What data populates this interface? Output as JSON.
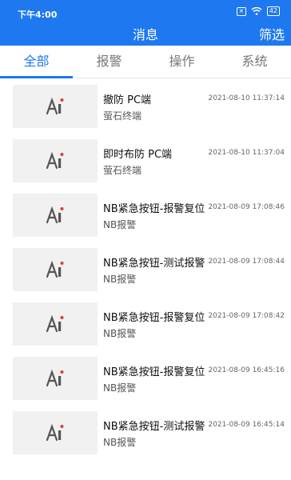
{
  "status_bar": {
    "time": "下午4:00",
    "battery": "42"
  },
  "header": {
    "title": "消息",
    "filter_label": "筛选"
  },
  "tabs": [
    {
      "label": "全部",
      "active": true
    },
    {
      "label": "报警",
      "active": false
    },
    {
      "label": "操作",
      "active": false
    },
    {
      "label": "系统",
      "active": false
    }
  ],
  "messages": [
    {
      "title": "撤防  PC端",
      "source": "萤石终端",
      "time": "2021-08-10 11:37:14",
      "icon": "ai-person-icon"
    },
    {
      "title": "即时布防  PC端",
      "source": "萤石终端",
      "time": "2021-08-10 11:37:04",
      "icon": "ai-person-icon"
    },
    {
      "title": "NB紧急按钮-报警复位",
      "source": "NB报警",
      "time": "2021-08-09 17:08:46",
      "icon": "ai-person-icon"
    },
    {
      "title": "NB紧急按钮-测试报警",
      "source": "NB报警",
      "time": "2021-08-09 17:08:44",
      "icon": "ai-person-icon"
    },
    {
      "title": "NB紧急按钮-报警复位",
      "source": "NB报警",
      "time": "2021-08-09 17:08:42",
      "icon": "ai-person-icon"
    },
    {
      "title": "NB紧急按钮-报警复位",
      "source": "NB报警",
      "time": "2021-08-09 16:45:16",
      "icon": "ai-person-icon"
    },
    {
      "title": "NB紧急按钮-测试报警",
      "source": "NB报警",
      "time": "2021-08-09 16:45:14",
      "icon": "ai-person-icon"
    }
  ],
  "colors": {
    "primary": "#1e78f0",
    "thumb_bg": "#f1f1f1",
    "alert_dot": "#e53935"
  }
}
